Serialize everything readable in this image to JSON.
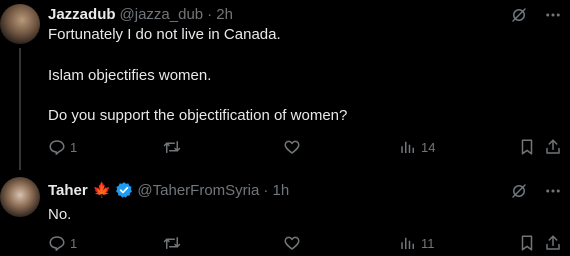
{
  "tweets": [
    {
      "author_name": "Jazzadub",
      "handle": "@jazza_dub",
      "time": "· 2h",
      "lines": [
        "Fortunately I do not live in Canada.",
        "Islam objectifies women.",
        "Do you support the objectification of women?"
      ],
      "replies": "1",
      "retweets": "",
      "likes": "",
      "views": "14"
    },
    {
      "author_name": "Taher",
      "flag_icon": "maple-leaf-icon",
      "verified": true,
      "handle": "@TaherFromSyria",
      "time": "· 1h",
      "lines": [
        "No."
      ],
      "replies": "1",
      "retweets": "",
      "likes": "",
      "views": "11"
    }
  ],
  "colors": {
    "background": "#000000",
    "text": "#e7e9ea",
    "muted": "#71767b",
    "verified": "#1d9bf0",
    "flag": "#e0242b",
    "divider": "#333639"
  }
}
